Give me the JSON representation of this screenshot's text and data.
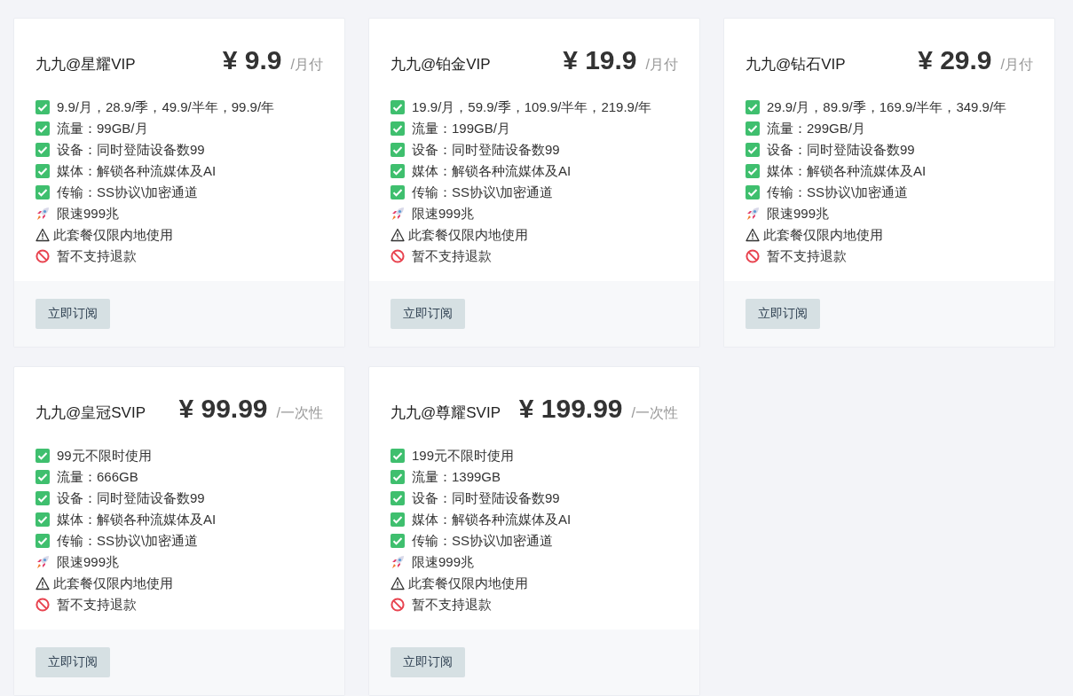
{
  "plans": [
    {
      "title": "九九@星耀VIP",
      "price": "¥ 9.9",
      "period": "/月付",
      "features": [
        {
          "kind": "check",
          "text": "9.9/月，28.9/季，49.9/半年，99.9/年"
        },
        {
          "kind": "check",
          "text": "流量：99GB/月"
        },
        {
          "kind": "check",
          "text": "设备：同时登陆设备数99"
        },
        {
          "kind": "check",
          "text": "媒体：解锁各种流媒体及AI"
        },
        {
          "kind": "check",
          "text": "传输：SS协议\\加密通道"
        },
        {
          "kind": "rocket",
          "text": "限速999兆"
        },
        {
          "kind": "warning",
          "text": "此套餐仅限内地使用"
        },
        {
          "kind": "forbidden",
          "text": "暂不支持退款"
        }
      ],
      "button": "立即订阅"
    },
    {
      "title": "九九@铂金VIP",
      "price": "¥ 19.9",
      "period": "/月付",
      "features": [
        {
          "kind": "check",
          "text": "19.9/月，59.9/季，109.9/半年，219.9/年"
        },
        {
          "kind": "check",
          "text": "流量：199GB/月"
        },
        {
          "kind": "check",
          "text": "设备：同时登陆设备数99"
        },
        {
          "kind": "check",
          "text": "媒体：解锁各种流媒体及AI"
        },
        {
          "kind": "check",
          "text": "传输：SS协议\\加密通道"
        },
        {
          "kind": "rocket",
          "text": "限速999兆"
        },
        {
          "kind": "warning",
          "text": "此套餐仅限内地使用"
        },
        {
          "kind": "forbidden",
          "text": "暂不支持退款"
        }
      ],
      "button": "立即订阅"
    },
    {
      "title": "九九@钻石VIP",
      "price": "¥ 29.9",
      "period": "/月付",
      "features": [
        {
          "kind": "check",
          "text": "29.9/月，89.9/季，169.9/半年，349.9/年"
        },
        {
          "kind": "check",
          "text": "流量：299GB/月"
        },
        {
          "kind": "check",
          "text": "设备：同时登陆设备数99"
        },
        {
          "kind": "check",
          "text": "媒体：解锁各种流媒体及AI"
        },
        {
          "kind": "check",
          "text": "传输：SS协议\\加密通道"
        },
        {
          "kind": "rocket",
          "text": "限速999兆"
        },
        {
          "kind": "warning",
          "text": "此套餐仅限内地使用"
        },
        {
          "kind": "forbidden",
          "text": "暂不支持退款"
        }
      ],
      "button": "立即订阅"
    },
    {
      "title": "九九@皇冠SVIP",
      "price": "¥ 99.99",
      "period": "/一次性",
      "features": [
        {
          "kind": "check",
          "text": "99元不限时使用"
        },
        {
          "kind": "check",
          "text": "流量：666GB"
        },
        {
          "kind": "check",
          "text": "设备：同时登陆设备数99"
        },
        {
          "kind": "check",
          "text": "媒体：解锁各种流媒体及AI"
        },
        {
          "kind": "check",
          "text": "传输：SS协议\\加密通道"
        },
        {
          "kind": "rocket",
          "text": "限速999兆"
        },
        {
          "kind": "warning",
          "text": "此套餐仅限内地使用"
        },
        {
          "kind": "forbidden",
          "text": "暂不支持退款"
        }
      ],
      "button": "立即订阅"
    },
    {
      "title": "九九@尊耀SVIP",
      "price": "¥ 199.99",
      "period": "/一次性",
      "features": [
        {
          "kind": "check",
          "text": "199元不限时使用"
        },
        {
          "kind": "check",
          "text": "流量：1399GB"
        },
        {
          "kind": "check",
          "text": "设备：同时登陆设备数99"
        },
        {
          "kind": "check",
          "text": "媒体：解锁各种流媒体及AI"
        },
        {
          "kind": "check",
          "text": "传输：SS协议\\加密通道"
        },
        {
          "kind": "rocket",
          "text": "限速999兆"
        },
        {
          "kind": "warning",
          "text": "此套餐仅限内地使用"
        },
        {
          "kind": "forbidden",
          "text": "暂不支持退款"
        }
      ],
      "button": "立即订阅"
    }
  ]
}
